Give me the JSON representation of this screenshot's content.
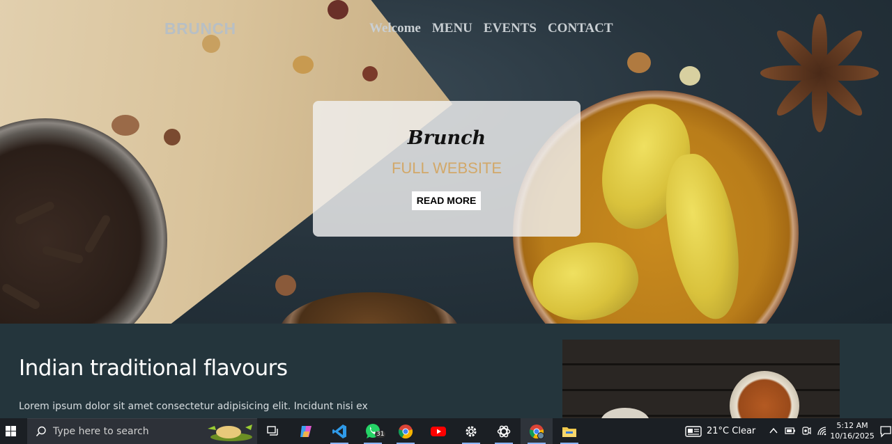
{
  "hero": {
    "brand": "BRUNCH",
    "nav": [
      "Welcome",
      "MENU",
      "EVENTS",
      "CONTACT"
    ],
    "card": {
      "title": "Brunch",
      "subtitle": "FULL WEBSITE",
      "button": "READ MORE"
    }
  },
  "content": {
    "heading": "Indian traditional flavours",
    "paragraph": "Lorem ipsum dolor sit amet consectetur adipisicing elit. Incidunt nisi ex"
  },
  "taskbar": {
    "search_placeholder": "Type here to search",
    "apps": [
      "task-view",
      "copilot",
      "vscode",
      "whatsapp",
      "chrome",
      "youtube",
      "settings",
      "chatgpt",
      "chrome-profile",
      "file-explorer"
    ],
    "whatsapp_badge": "31",
    "weather": "21°C  Clear",
    "time": "5:12 AM",
    "date": "10/16/2025"
  },
  "colors": {
    "content_bg": "#24353c",
    "card_subtitle": "#d2a869",
    "taskbar_bg": "#1b1f24"
  }
}
